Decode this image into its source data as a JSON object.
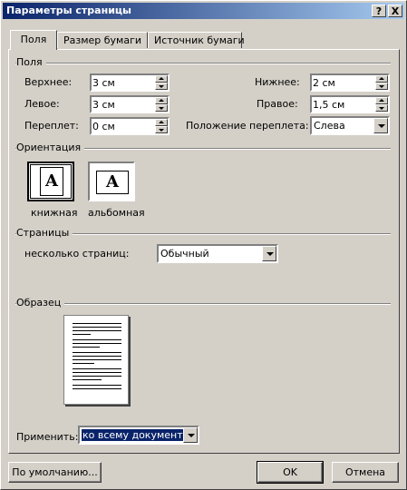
{
  "window": {
    "title": "Параметры страницы",
    "help_label": "?",
    "close_label": "X"
  },
  "tabs": [
    {
      "label": "Поля"
    },
    {
      "label": "Размер бумаги"
    },
    {
      "label": "Источник бумаги"
    }
  ],
  "margins": {
    "group_title": "Поля",
    "top": {
      "label": "Верхнее:",
      "value": "3 см"
    },
    "bottom": {
      "label": "Нижнее:",
      "value": "2 см"
    },
    "left": {
      "label": "Левое:",
      "value": "3 см"
    },
    "right": {
      "label": "Правое:",
      "value": "1,5 см"
    },
    "gutter": {
      "label": "Переплет:",
      "value": "0 см"
    },
    "gutter_position": {
      "label": "Положение переплета:",
      "value": "Слева"
    }
  },
  "orientation": {
    "group_title": "Ориентация",
    "portrait": {
      "label": "книжная",
      "glyph": "A",
      "selected": true
    },
    "landscape": {
      "label": "альбомная",
      "glyph": "A",
      "selected": false
    }
  },
  "pages": {
    "group_title": "Страницы",
    "multiple_label": "несколько страниц:",
    "multiple_value": "Обычный"
  },
  "preview": {
    "group_title": "Образец"
  },
  "apply": {
    "label": "Применить:",
    "value": "ко всему документу"
  },
  "buttons": {
    "default": "По умолчанию...",
    "ok": "OK",
    "cancel": "Отмена"
  }
}
